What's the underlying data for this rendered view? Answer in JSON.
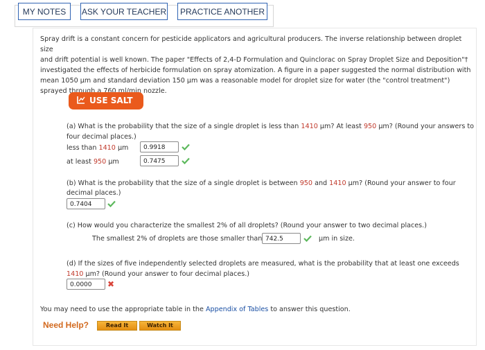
{
  "toolbar": {
    "my_notes": "MY NOTES",
    "ask_teacher": "ASK YOUR TEACHER",
    "practice_another": "PRACTICE ANOTHER"
  },
  "intro": {
    "p1": "Spray drift is a constant concern for pesticide applicators and agricultural producers. The inverse relationship between droplet size",
    "p2": "and drift potential is well known. The paper \"Effects of 2,4-D Formulation and Quinclorac on Spray Droplet Size and Deposition\"†",
    "p3": "investigated the effects of herbicide formulation on spray atomization. A figure in a paper suggested the normal distribution with",
    "p4": "mean 1050 μm and standard deviation 150 μm was a reasonable model for droplet size for water (the \"control treatment\")",
    "p5": "sprayed through a 760 ml/min nozzle."
  },
  "salt_button": "USE SALT",
  "part_a": {
    "q1_pre": "(a) What is the probability that the size of a single droplet is less than ",
    "q1_val1": "1410",
    "q1_mid": " μm? At least ",
    "q1_val2": "950",
    "q1_post": " μm? (Round your answers to",
    "q2": "four decimal places.)",
    "row1_pre": "less than ",
    "row1_val": "1410",
    "row1_unit": " μm",
    "row1_answer": "0.9918",
    "row2_pre": "at least ",
    "row2_val": "950",
    "row2_unit": " μm",
    "row2_answer": "0.7475"
  },
  "part_b": {
    "q1_pre": "(b) What is the probability that the size of a single droplet is between ",
    "q1_val1": "950",
    "q1_mid": " and ",
    "q1_val2": "1410",
    "q1_post": " μm? (Round your answer to four",
    "q2": "decimal places.)",
    "answer": "0.7404"
  },
  "part_c": {
    "q1": "(c) How would you characterize the smallest 2% of all droplets? (Round your answer to two decimal places.)",
    "row_pre": "The smallest 2% of droplets are those smaller than",
    "answer": "742.5",
    "row_post": "μm in size."
  },
  "part_d": {
    "q1": "(d) If the sizes of five independently selected droplets are measured, what is the probability that at least one exceeds",
    "q2_val": "1410",
    "q2_post": " μm? (Round your answer to four decimal places.)",
    "answer": "0.0000"
  },
  "appendix": {
    "pre": "You may need to use the appropriate table in the ",
    "link": "Appendix of Tables",
    "post": " to answer this question."
  },
  "help": {
    "label": "Need Help?",
    "read_it": "Read It",
    "watch_it": "Watch It"
  },
  "colors": {
    "accent_orange": "#ea5a1c",
    "highlight_red": "#c0392b",
    "check_green": "#5cb85c",
    "link_blue": "#1a4fa3"
  }
}
